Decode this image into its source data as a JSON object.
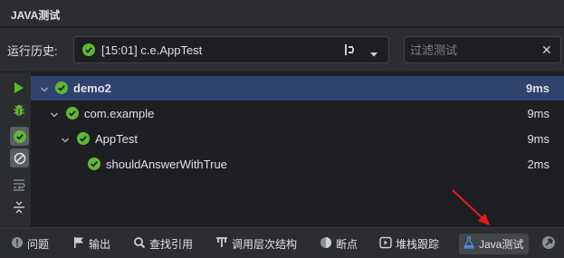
{
  "window": {
    "title": "JAVA测试"
  },
  "history": {
    "label": "运行历史:",
    "selected": "[15:01] c.e.AppTest",
    "filter_placeholder": "过滤测试"
  },
  "tree": {
    "rows": [
      {
        "name": "demo2",
        "duration": "9ms"
      },
      {
        "name": "com.example",
        "duration": "9ms"
      },
      {
        "name": "AppTest",
        "duration": "9ms"
      },
      {
        "name": "shouldAnswerWithTrue",
        "duration": "2ms"
      }
    ]
  },
  "bottom_tabs": [
    {
      "label": "问题",
      "icon": "warning-icon"
    },
    {
      "label": "输出",
      "icon": "flag-icon"
    },
    {
      "label": "查找引用",
      "icon": "search-icon"
    },
    {
      "label": "调用层次结构",
      "icon": "hierarchy-icon"
    },
    {
      "label": "断点",
      "icon": "breakpoint-icon"
    },
    {
      "label": "堆栈跟踪",
      "icon": "stack-trace-icon"
    },
    {
      "label": "Java测试",
      "icon": "flask-icon"
    }
  ],
  "colors": {
    "success": "#5fb832",
    "accent": "#4c8fe8",
    "annotation_arrow": "#e81b1b"
  }
}
